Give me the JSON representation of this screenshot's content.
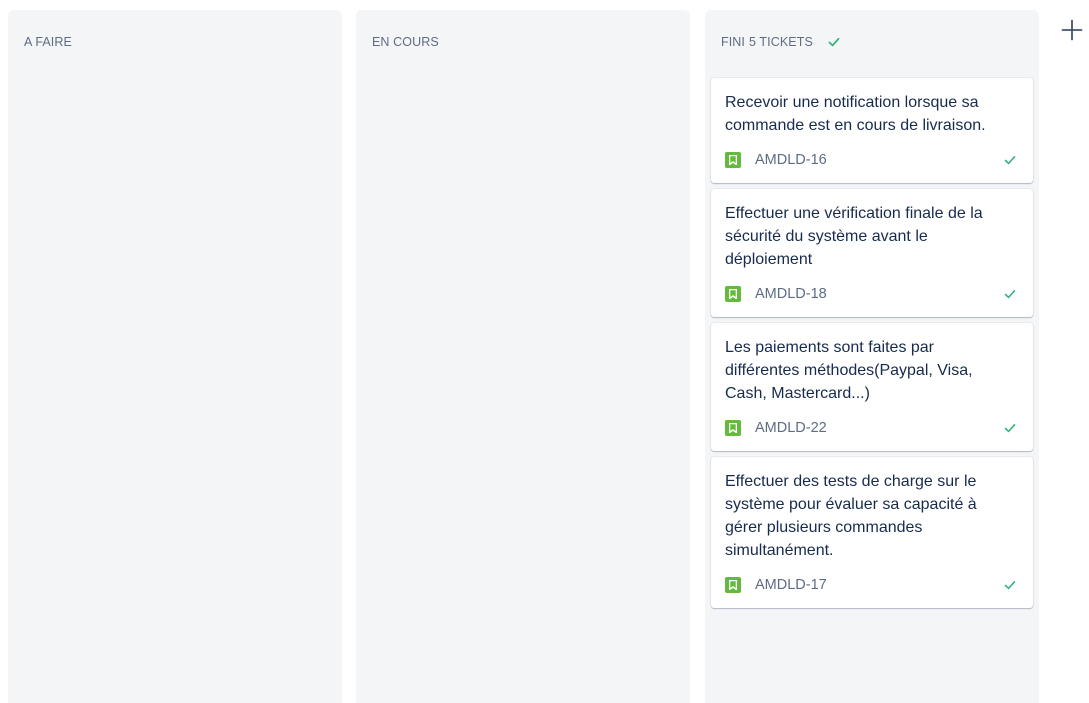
{
  "columns": [
    {
      "title": "A FAIRE",
      "count": "",
      "cards": []
    },
    {
      "title": "EN COURS",
      "count": "",
      "cards": []
    },
    {
      "title": "FINI",
      "count": "5 TICKETS",
      "done": true
    }
  ],
  "cards": [
    {
      "summary": "Recevoir une notification lorsque sa commande est en cours de livraison.",
      "key": "AMDLD-16"
    },
    {
      "summary": "Effectuer une vérification finale de la sécurité du système avant le déploiement",
      "key": "AMDLD-18"
    },
    {
      "summary": "Les paiements sont faites par différentes méthodes(Paypal, Visa, Cash, Mastercard...)",
      "key": "AMDLD-22"
    },
    {
      "summary": "Effectuer des tests de charge sur le système pour évaluer sa capacité à gérer plusieurs commandes simultanément.",
      "key": "AMDLD-17"
    }
  ],
  "icons": {
    "issue_type": "story-bookmark-icon",
    "done": "checkmark-icon",
    "add_column": "plus-icon"
  },
  "colors": {
    "column_bg": "#f4f5f7",
    "story_green": "#63ba3c",
    "done_green": "#36b37e",
    "text_primary": "#172b4d",
    "text_secondary": "#5e6c84"
  }
}
